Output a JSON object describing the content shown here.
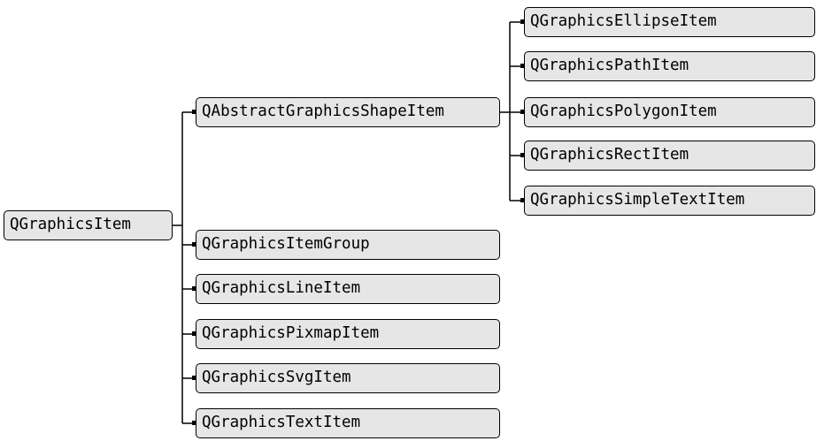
{
  "colors": {
    "node_fill": "#e6e6e6",
    "node_border": "#000000",
    "line": "#000000",
    "background": "#ffffff"
  },
  "diagram": {
    "root": {
      "label": "QGraphicsItem"
    },
    "children": [
      {
        "label": "QAbstractGraphicsShapeItem"
      },
      {
        "label": "QGraphicsItemGroup"
      },
      {
        "label": "QGraphicsLineItem"
      },
      {
        "label": "QGraphicsPixmapItem"
      },
      {
        "label": "QGraphicsSvgItem"
      },
      {
        "label": "QGraphicsTextItem"
      }
    ],
    "shape_children": [
      {
        "label": "QGraphicsEllipseItem"
      },
      {
        "label": "QGraphicsPathItem"
      },
      {
        "label": "QGraphicsPolygonItem"
      },
      {
        "label": "QGraphicsRectItem"
      },
      {
        "label": "QGraphicsSimpleTextItem"
      }
    ]
  }
}
